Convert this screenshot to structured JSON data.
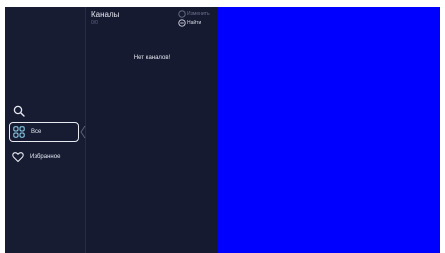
{
  "sidebar": {
    "search_icon": "search-icon",
    "items": [
      {
        "label": "Все",
        "icon": "grid-icon",
        "selected": true
      },
      {
        "label": "Избранное",
        "icon": "heart-icon",
        "selected": false
      }
    ]
  },
  "channel_list": {
    "title": "Каналы",
    "count": "0/0",
    "edit_label": "Изменить",
    "find_label": "Найти",
    "empty_message": "Нет каналов!"
  },
  "colors": {
    "background": "#171c33",
    "player": "#0000fe",
    "text": "#e6e8f0"
  }
}
